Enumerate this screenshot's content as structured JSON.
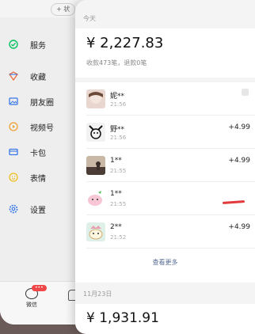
{
  "back": {
    "status_pill": "+ 状",
    "menu": [
      {
        "label": "服务",
        "icon": "service-icon"
      },
      {
        "label": "收藏",
        "icon": "favorites-icon"
      },
      {
        "label": "朋友圈",
        "icon": "moments-icon"
      },
      {
        "label": "视频号",
        "icon": "channels-icon"
      },
      {
        "label": "卡包",
        "icon": "card-wallet-icon"
      },
      {
        "label": "表情",
        "icon": "sticker-icon"
      },
      {
        "label": "设置",
        "icon": "settings-icon"
      }
    ],
    "tab_label": "微信",
    "badge": "•••"
  },
  "card": {
    "today_label": "今天",
    "today_amount": "¥ 2,227.83",
    "today_summary": "收款473笔，退款0笔",
    "transactions": [
      {
        "name": "妮**",
        "time": "21:56",
        "amount": ""
      },
      {
        "name": "野**",
        "time": "21:56",
        "amount": "+4.99"
      },
      {
        "name": "1**",
        "time": "21:55",
        "amount": "+4.99"
      },
      {
        "name": "1**",
        "time": "21:55",
        "amount": ""
      },
      {
        "name": "2**",
        "time": "21:52",
        "amount": "+4.99"
      }
    ],
    "view_more": "查看更多",
    "prev_day_label": "11月23日",
    "prev_amount": "¥ 1,931.91"
  }
}
